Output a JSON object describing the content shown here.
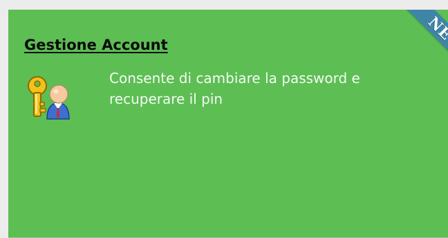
{
  "card": {
    "title": "Gestione Account",
    "description": "Consente di cambiare la password e recuperare il pin",
    "icon": "key-user-icon",
    "badge": "NEW",
    "colors": {
      "background": "#5dbe54",
      "ribbon": "#3f86a6",
      "page": "#ececec"
    }
  }
}
